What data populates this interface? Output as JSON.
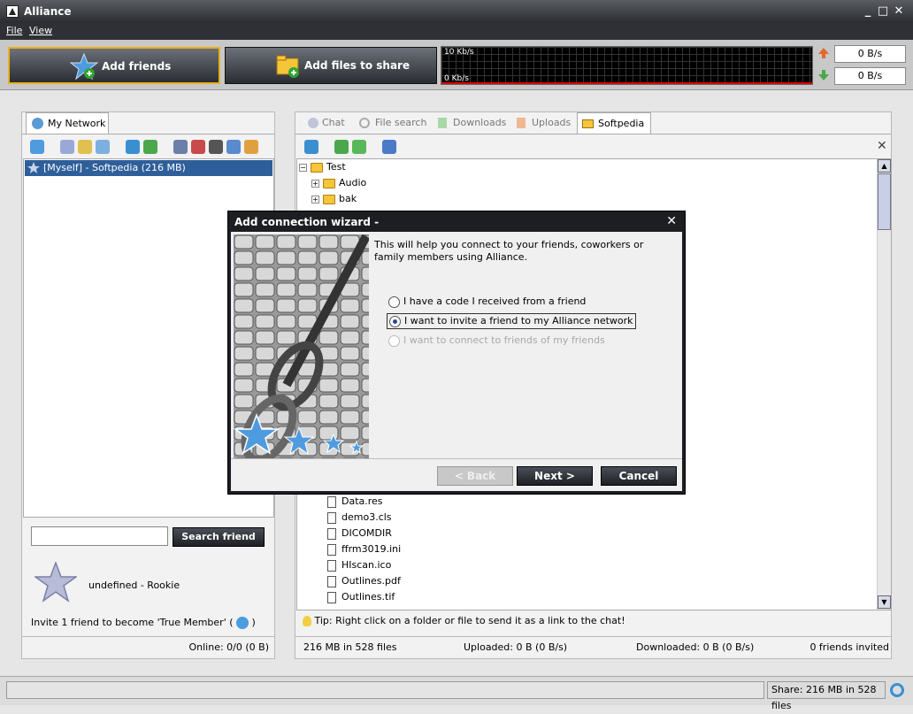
{
  "window": {
    "title": "Alliance"
  },
  "menu": {
    "file": "File",
    "view": "View"
  },
  "toolbar": {
    "add_friends": "Add friends",
    "add_files": "Add files to share",
    "graph_top": "10 Kb/s",
    "graph_bottom": "0 Kb/s",
    "upload_rate": "0 B/s",
    "download_rate": "0 B/s"
  },
  "left_panel": {
    "tab": "My Network",
    "myself": "[Myself] - Softpedia (216 MB)",
    "search_placeholder": "",
    "search_button": "Search friend",
    "user_status": "undefined  - Rookie",
    "invite_text": "Invite 1 friend to become 'True Member' (",
    "invite_suffix": ")",
    "online": "Online: 0/0 (0 B)"
  },
  "right_panel": {
    "tabs": [
      "Chat",
      "File search",
      "Downloads",
      "Uploads",
      "Softpedia"
    ],
    "tree_folders": [
      {
        "name": "Test",
        "expander": "−"
      },
      {
        "name": "Audio",
        "expander": "+"
      },
      {
        "name": "bak",
        "expander": "+"
      }
    ],
    "tree_files": [
      "Data.res",
      "demo3.cls",
      "DICOMDIR",
      "ffrm3019.ini",
      "HIscan.ico",
      "Outlines.pdf",
      "Outlines.tif"
    ],
    "tip": "Tip: Right click on a folder or file to send it as a link to the chat!",
    "stat_size": "216 MB in 528 files",
    "stat_uploaded": "Uploaded: 0 B (0 B/s)",
    "stat_downloaded": "Downloaded: 0 B (0 B/s)",
    "stat_invited": "0 friends invited"
  },
  "statusbar": {
    "share": "Share: 216 MB in 528 files"
  },
  "dialog": {
    "title": "Add connection wizard -",
    "intro": "This will help you connect to your friends, coworkers or family members using Alliance.",
    "options": [
      {
        "label": "I have a code I received from a friend",
        "selected": false,
        "enabled": true
      },
      {
        "label": "I want to invite a friend to my Alliance network",
        "selected": true,
        "enabled": true
      },
      {
        "label": "I want to connect to friends of my friends",
        "selected": false,
        "enabled": false
      }
    ],
    "back": "< Back",
    "next": "Next >",
    "cancel": "Cancel"
  },
  "colors": {
    "accent": "#e8b020",
    "dark_chrome": "#2e3035",
    "selection": "#2f5f9a"
  }
}
